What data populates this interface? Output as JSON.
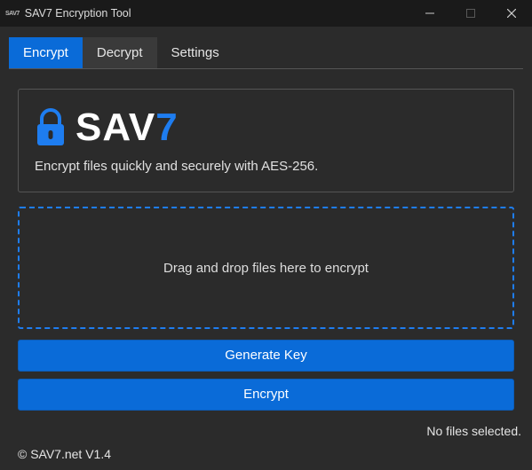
{
  "window": {
    "title": "SAV7 Encryption Tool",
    "small_logo": "SAV7"
  },
  "tabs": [
    {
      "label": "Encrypt",
      "active": true
    },
    {
      "label": "Decrypt",
      "active": false
    },
    {
      "label": "Settings",
      "active": false
    }
  ],
  "hero": {
    "logo_prefix": "SAV",
    "logo_suffix": "7",
    "subtitle": "Encrypt files quickly and securely with AES-256."
  },
  "dropzone": {
    "text": "Drag and drop files here to encrypt"
  },
  "buttons": {
    "generate_key": "Generate Key",
    "encrypt": "Encrypt"
  },
  "status": "No files selected.",
  "footer": "© SAV7.net V1.4",
  "icons": {
    "lock": "lock-icon",
    "minimize": "minimize-icon",
    "maximize": "maximize-icon",
    "close": "close-icon"
  },
  "colors": {
    "accent": "#0a6bd8",
    "accent_light": "#1e7df0",
    "bg": "#2b2b2b",
    "titlebar": "#1a1a1a"
  }
}
